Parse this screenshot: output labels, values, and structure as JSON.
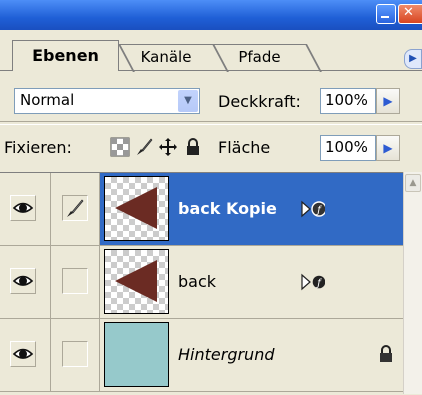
{
  "tabs": [
    {
      "label": "Ebenen",
      "active": true
    },
    {
      "label": "Kanäle",
      "active": false
    },
    {
      "label": "Pfade",
      "active": false
    }
  ],
  "blend_mode": {
    "value": "Normal"
  },
  "opacity": {
    "label": "Deckkraft:",
    "value": "100%"
  },
  "lock": {
    "label": "Fixieren:"
  },
  "fill": {
    "label": "Fläche",
    "value": "100%"
  },
  "layers": [
    {
      "name": "back Kopie",
      "selected": true,
      "visible": true,
      "thumb": "red-triangle",
      "has_fx": true
    },
    {
      "name": "back",
      "selected": false,
      "visible": true,
      "thumb": "red-triangle",
      "has_fx": true
    },
    {
      "name": "Hintergrund",
      "selected": false,
      "visible": true,
      "thumb": "solid-teal",
      "locked": true
    }
  ],
  "colors": {
    "selection": "#316ac5",
    "triangle": "#6b2b23",
    "background_fill": "#96c9cb",
    "titlebar": "#2461d8"
  },
  "icons": [
    "minimize-icon",
    "close-icon",
    "dropdown-arrow-icon",
    "right-arrow-icon",
    "lock-transparency-icon",
    "lock-brush-icon",
    "move-icon",
    "lock-all-icon",
    "eye-icon",
    "brush-icon",
    "fx-icon",
    "lock-icon",
    "scroll-up-icon"
  ]
}
